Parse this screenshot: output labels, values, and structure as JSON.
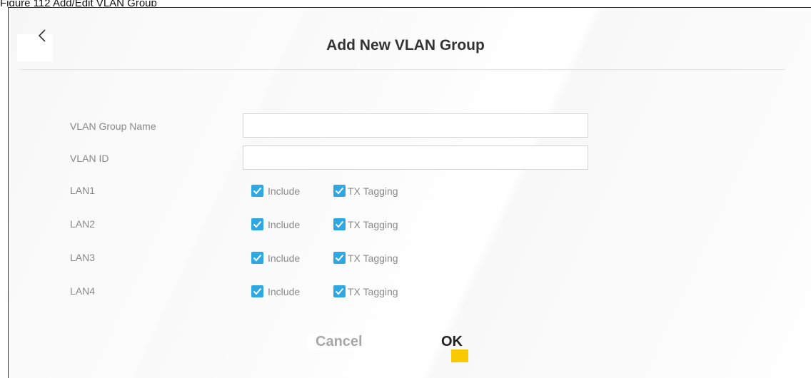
{
  "caption": "Figure 112   Add/Edit VLAN Group",
  "dialog": {
    "title": "Add New VLAN Group"
  },
  "fields": {
    "group_name_label": "VLAN Group Name",
    "group_name_value": "",
    "vlan_id_label": "VLAN ID",
    "vlan_id_value": ""
  },
  "lan_rows": [
    {
      "label": "LAN1",
      "include_label": "Include",
      "include_checked": true,
      "tx_label": "TX Tagging",
      "tx_checked": true
    },
    {
      "label": "LAN2",
      "include_label": "Include",
      "include_checked": true,
      "tx_label": "TX Tagging",
      "tx_checked": true
    },
    {
      "label": "LAN3",
      "include_label": "Include",
      "include_checked": true,
      "tx_label": "TX Tagging",
      "tx_checked": true
    },
    {
      "label": "LAN4",
      "include_label": "Include",
      "include_checked": true,
      "tx_label": "TX Tagging",
      "tx_checked": true
    }
  ],
  "buttons": {
    "cancel": "Cancel",
    "ok": "OK"
  },
  "icons": {
    "back": "chevron-left-icon",
    "check": "check-icon"
  },
  "colors": {
    "checkbox": "#2da8e2",
    "ok_accent": "#f8c800"
  }
}
